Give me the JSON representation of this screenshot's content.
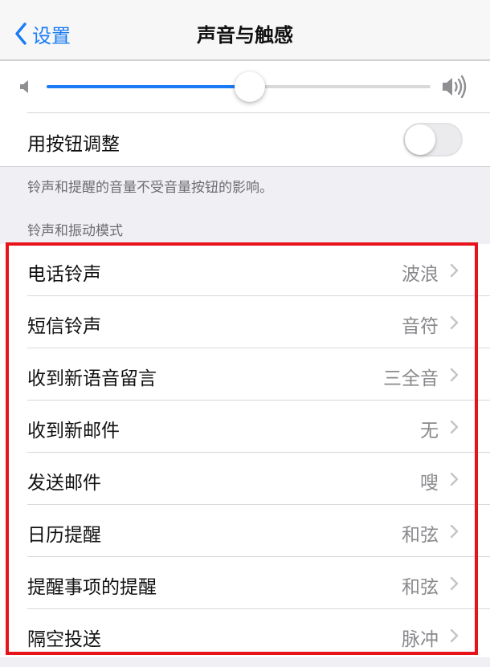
{
  "nav": {
    "back_label": "设置",
    "title": "声音与触感"
  },
  "volume": {
    "level": 0.53
  },
  "button_adjust": {
    "label": "用按钮调整",
    "enabled": false
  },
  "footnote": "铃声和提醒的音量不受音量按钮的影响。",
  "section_header": "铃声和振动模式",
  "items": [
    {
      "label": "电话铃声",
      "value": "波浪"
    },
    {
      "label": "短信铃声",
      "value": "音符"
    },
    {
      "label": "收到新语音留言",
      "value": "三全音"
    },
    {
      "label": "收到新邮件",
      "value": "无"
    },
    {
      "label": "发送邮件",
      "value": "嗖"
    },
    {
      "label": "日历提醒",
      "value": "和弦"
    },
    {
      "label": "提醒事项的提醒",
      "value": "和弦"
    },
    {
      "label": "隔空投送",
      "value": "脉冲"
    }
  ],
  "colors": {
    "accent": "#1a7cf5",
    "highlight": "#e8121b"
  },
  "icons": {
    "back": "chevron-left-icon",
    "volume_low": "speaker-low-icon",
    "volume_high": "speaker-high-icon",
    "disclosure": "chevron-right-icon"
  }
}
